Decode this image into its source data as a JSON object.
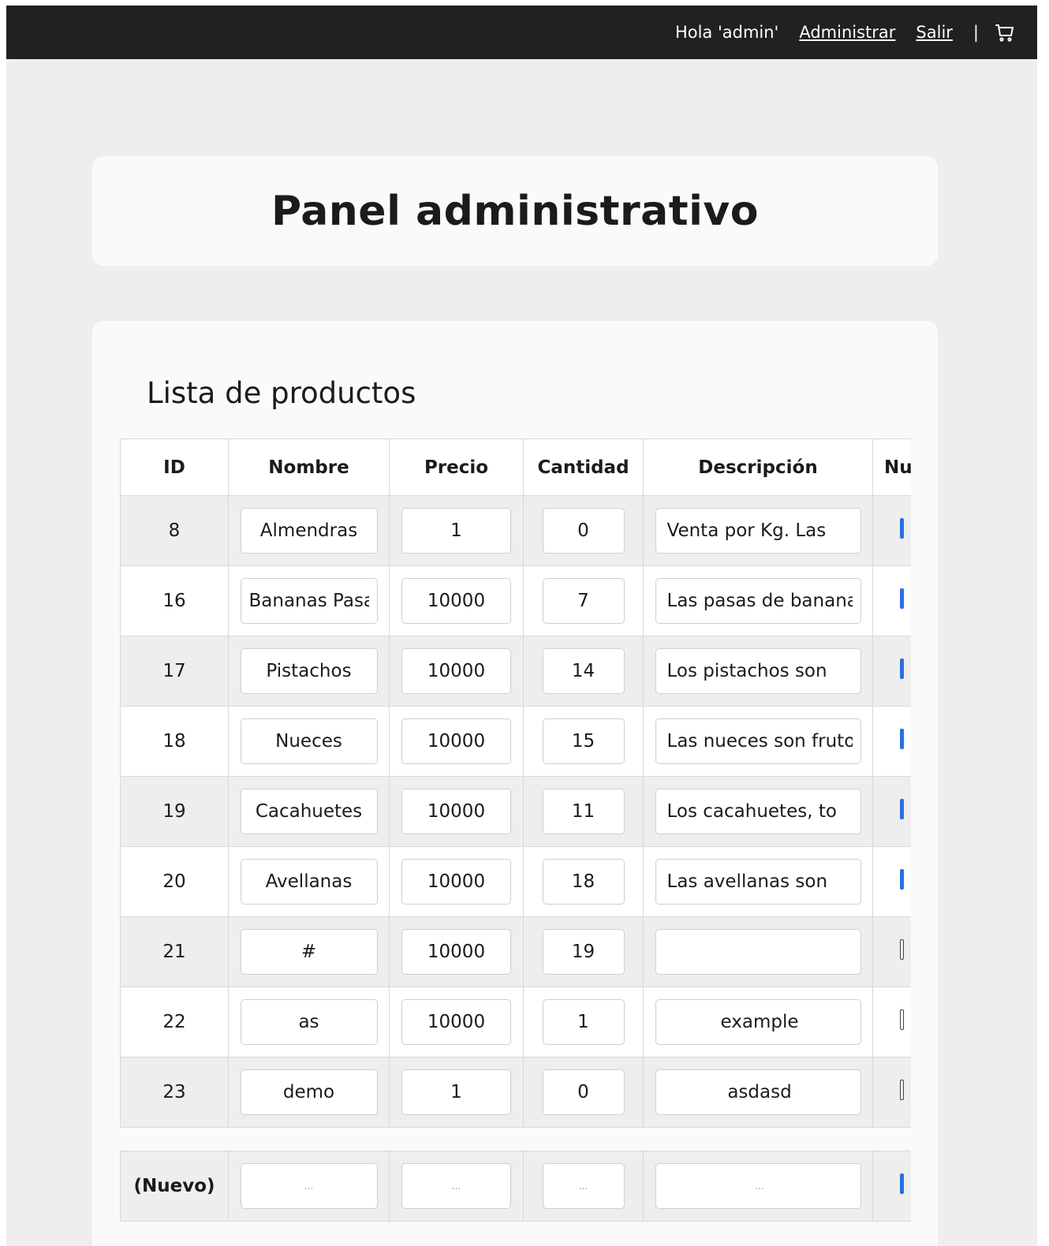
{
  "header": {
    "greeting": "Hola 'admin'",
    "admin_link": "Administrar",
    "logout_link": "Salir",
    "separator": "|"
  },
  "title": "Panel administrativo",
  "list": {
    "heading": "Lista de productos",
    "columns": [
      "ID",
      "Nombre",
      "Precio",
      "Cantidad",
      "Descripción",
      "Nu"
    ],
    "rows": [
      {
        "id": "8",
        "name": "Almendras",
        "price": "1",
        "qty": "0",
        "desc": "Venta por Kg. Las",
        "marker": "filled"
      },
      {
        "id": "16",
        "name": "Bananas Pasas",
        "price": "10000",
        "qty": "7",
        "desc": "Las pasas de banana",
        "marker": "filled"
      },
      {
        "id": "17",
        "name": "Pistachos",
        "price": "10000",
        "qty": "14",
        "desc": "Los pistachos son",
        "marker": "filled"
      },
      {
        "id": "18",
        "name": "Nueces",
        "price": "10000",
        "qty": "15",
        "desc": "Las nueces son fruto",
        "marker": "filled"
      },
      {
        "id": "19",
        "name": "Cacahuetes",
        "price": "10000",
        "qty": "11",
        "desc": "Los cacahuetes, to",
        "marker": "filled"
      },
      {
        "id": "20",
        "name": "Avellanas",
        "price": "10000",
        "qty": "18",
        "desc": "Las avellanas son",
        "marker": "filled"
      },
      {
        "id": "21",
        "name": "#",
        "price": "10000",
        "qty": "19",
        "desc": "",
        "marker": "empty"
      },
      {
        "id": "22",
        "name": "as",
        "price": "10000",
        "qty": "1",
        "desc": "example",
        "marker": "empty"
      },
      {
        "id": "23",
        "name": "demo",
        "price": "1",
        "qty": "0",
        "desc": "asdasd",
        "marker": "empty"
      }
    ],
    "new_row": {
      "label": "(Nuevo)",
      "placeholder": "..."
    }
  },
  "colors": {
    "topbar": "#212121",
    "page_bg": "#eeeeee",
    "card_bg": "#fafafa",
    "accent": "#2b6fe0"
  },
  "icons": {
    "cart": "cart-icon"
  }
}
